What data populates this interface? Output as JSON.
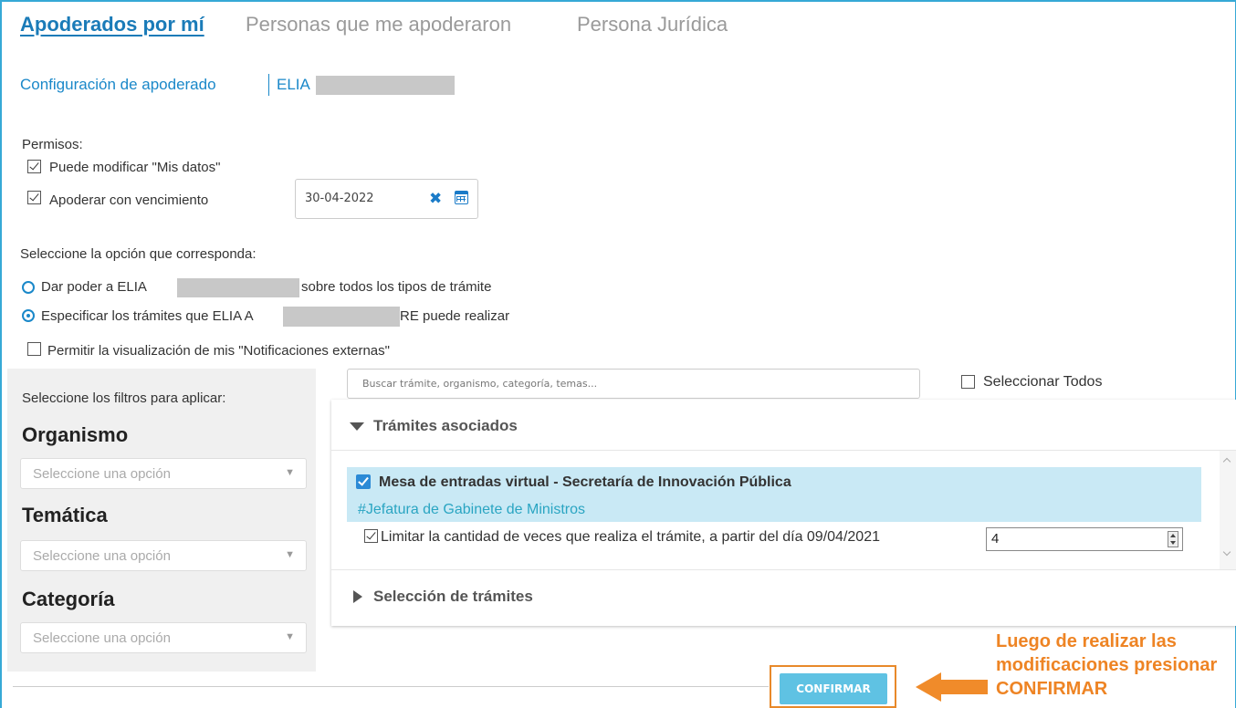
{
  "tabs": [
    "Apoderados por mí",
    "Personas que me apoderaron",
    "Persona Jurídica"
  ],
  "breadcrumb": {
    "section": "Configuración de apoderado",
    "person": "ELIA"
  },
  "permisos": {
    "label": "Permisos:",
    "modificar": "Puede modificar \"Mis datos\"",
    "vencimiento": "Apoderar con vencimiento",
    "fecha": "30-04-2022"
  },
  "opciones": {
    "label": "Seleccione la opción que corresponda:",
    "dar_poder_a": "Dar poder a ELIA",
    "dar_poder_b": "sobre todos los tipos de trámite",
    "especificar_a": "Especificar los trámites que ELIA A",
    "especificar_b": "RE puede realizar",
    "notificaciones": "Permitir la visualización de mis \"Notificaciones externas\""
  },
  "filtros": {
    "label": "Seleccione los filtros para aplicar:",
    "organismo": "Organismo",
    "tematica": "Temática",
    "categoria": "Categoría",
    "placeholder": "Seleccione una opción"
  },
  "buscar_placeholder": "Buscar trámite, organismo, categoría, temas...",
  "seleccionar_todos": "Seleccionar Todos",
  "tramites_asociados": "Trámites asociados",
  "tramite": {
    "nombre": "Mesa de entradas virtual - Secretaría de Innovación Pública",
    "organismo": "#Jefatura de Gabinete de Ministros",
    "limitar": "Limitar la cantidad de veces que realiza el trámite, a partir del día 09/04/2021",
    "cantidad": "4"
  },
  "seleccion_tramites": "Selección de trámites",
  "confirmar": "CONFIRMAR",
  "nota": "Luego de realizar las modificaciones presionar CONFIRMAR",
  "colors": {
    "accent": "#1a88c9",
    "highlight": "#c9e9f5",
    "orange": "#ee8424",
    "button": "#5fc2e3"
  },
  "icons": [
    "calendar-icon",
    "clear-icon",
    "caret-down-icon",
    "caret-right-icon",
    "arrow-left-icon"
  ]
}
